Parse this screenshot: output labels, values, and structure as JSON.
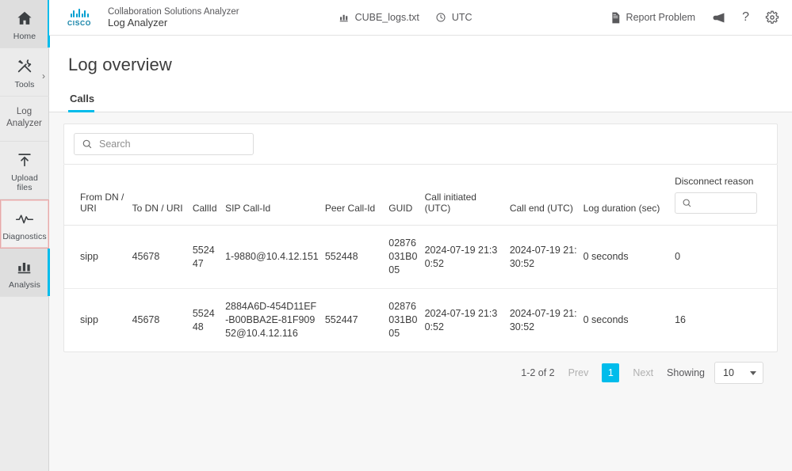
{
  "sidebar": {
    "items": [
      {
        "id": "home",
        "label": "Home",
        "icon": "home-icon",
        "state": "active"
      },
      {
        "id": "tools",
        "label": "Tools",
        "icon": "tools-icon",
        "state": "default",
        "chevron": "›"
      }
    ],
    "section": {
      "id": "log-analyzer",
      "label_line1": "Log",
      "label_line2": "Analyzer"
    },
    "sub_items": [
      {
        "id": "upload-files",
        "label_line1": "Upload",
        "label_line2": "files",
        "icon": "upload-icon",
        "state": "default"
      },
      {
        "id": "diagnostics",
        "label_line1": "Diagnostics",
        "label_line2": "",
        "icon": "pulse-icon",
        "state": "focused"
      },
      {
        "id": "analysis",
        "label_line1": "Analysis",
        "label_line2": "",
        "icon": "bar-chart-icon",
        "state": "active"
      }
    ]
  },
  "header": {
    "brand_logo": "cisco-logo",
    "brand_line1": "Collaboration Solutions Analyzer",
    "brand_line2": "Log Analyzer",
    "file_chip": {
      "icon": "bar-chart-icon",
      "label": "CUBE_logs.txt"
    },
    "timezone_chip": {
      "icon": "clock-icon",
      "label": "UTC"
    },
    "report_problem": {
      "icon": "document-icon",
      "label": "Report Problem"
    },
    "announcement_icon": "megaphone-icon",
    "help_icon": "question-mark-icon",
    "settings_icon": "gear-icon"
  },
  "page": {
    "title": "Log overview",
    "tabs": [
      {
        "id": "calls",
        "label": "Calls",
        "active": true
      }
    ]
  },
  "search": {
    "placeholder": "Search",
    "value": "",
    "icon": "search-icon"
  },
  "table": {
    "columns": [
      "From DN / URI",
      "To DN / URI",
      "CallId",
      "SIP Call-Id",
      "Peer Call-Id",
      "GUID",
      "Call initiated (UTC)",
      "Call end (UTC)",
      "Log duration (sec)"
    ],
    "filter_column": {
      "label": "Disconnect reason",
      "placeholder": "",
      "value": "",
      "icon": "search-icon"
    },
    "rows": [
      {
        "from_dn_uri": "sipp",
        "to_dn_uri": "45678",
        "call_id": "552447",
        "sip_call_id": "1-9880@10.4.12.151",
        "peer_call_id": "552448",
        "guid": "02876031B005",
        "call_initiated": "2024-07-19 21:30:52",
        "call_end": "2024-07-19 21:30:52",
        "log_duration": "0 seconds",
        "disconnect_reason": "0"
      },
      {
        "from_dn_uri": "sipp",
        "to_dn_uri": "45678",
        "call_id": "552448",
        "sip_call_id": "2884A6D-454D11EF-B00BBA2E-81F90952@10.4.12.116",
        "peer_call_id": "552447",
        "guid": "02876031B005",
        "call_initiated": "2024-07-19 21:30:52",
        "call_end": "2024-07-19 21:30:52",
        "log_duration": "0 seconds",
        "disconnect_reason": "16"
      }
    ]
  },
  "pagination": {
    "range": "1-2 of 2",
    "prev_label": "Prev",
    "current_page": "1",
    "next_label": "Next",
    "showing_label": "Showing",
    "page_size": "10"
  },
  "colors": {
    "accent": "#00bceb",
    "cisco_blue": "#0d7fa5",
    "text": "#3c3c3c",
    "muted": "#58585b"
  }
}
